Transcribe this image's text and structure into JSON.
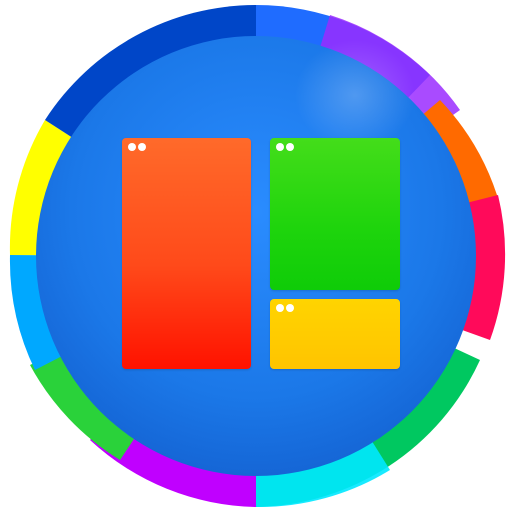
{
  "icon": {
    "name": "window-layout-app-icon",
    "colors": {
      "background_blue": "#1b78e8",
      "pane_left": "#ff4a1a",
      "pane_top_right": "#1ed40c",
      "pane_bottom_right": "#ffc400",
      "window_dots": "#ffffff"
    },
    "ring_colors": [
      "#00b0ff",
      "#0050e0",
      "#7a2cff",
      "#ff00c8",
      "#ff7a00",
      "#ff0060",
      "#00cc30",
      "#00ffff",
      "#ff00ff",
      "#ffff00"
    ],
    "panes": [
      {
        "name": "left-pane",
        "dots": 2
      },
      {
        "name": "top-right-pane",
        "dots": 2
      },
      {
        "name": "bottom-right-pane",
        "dots": 2
      }
    ]
  }
}
